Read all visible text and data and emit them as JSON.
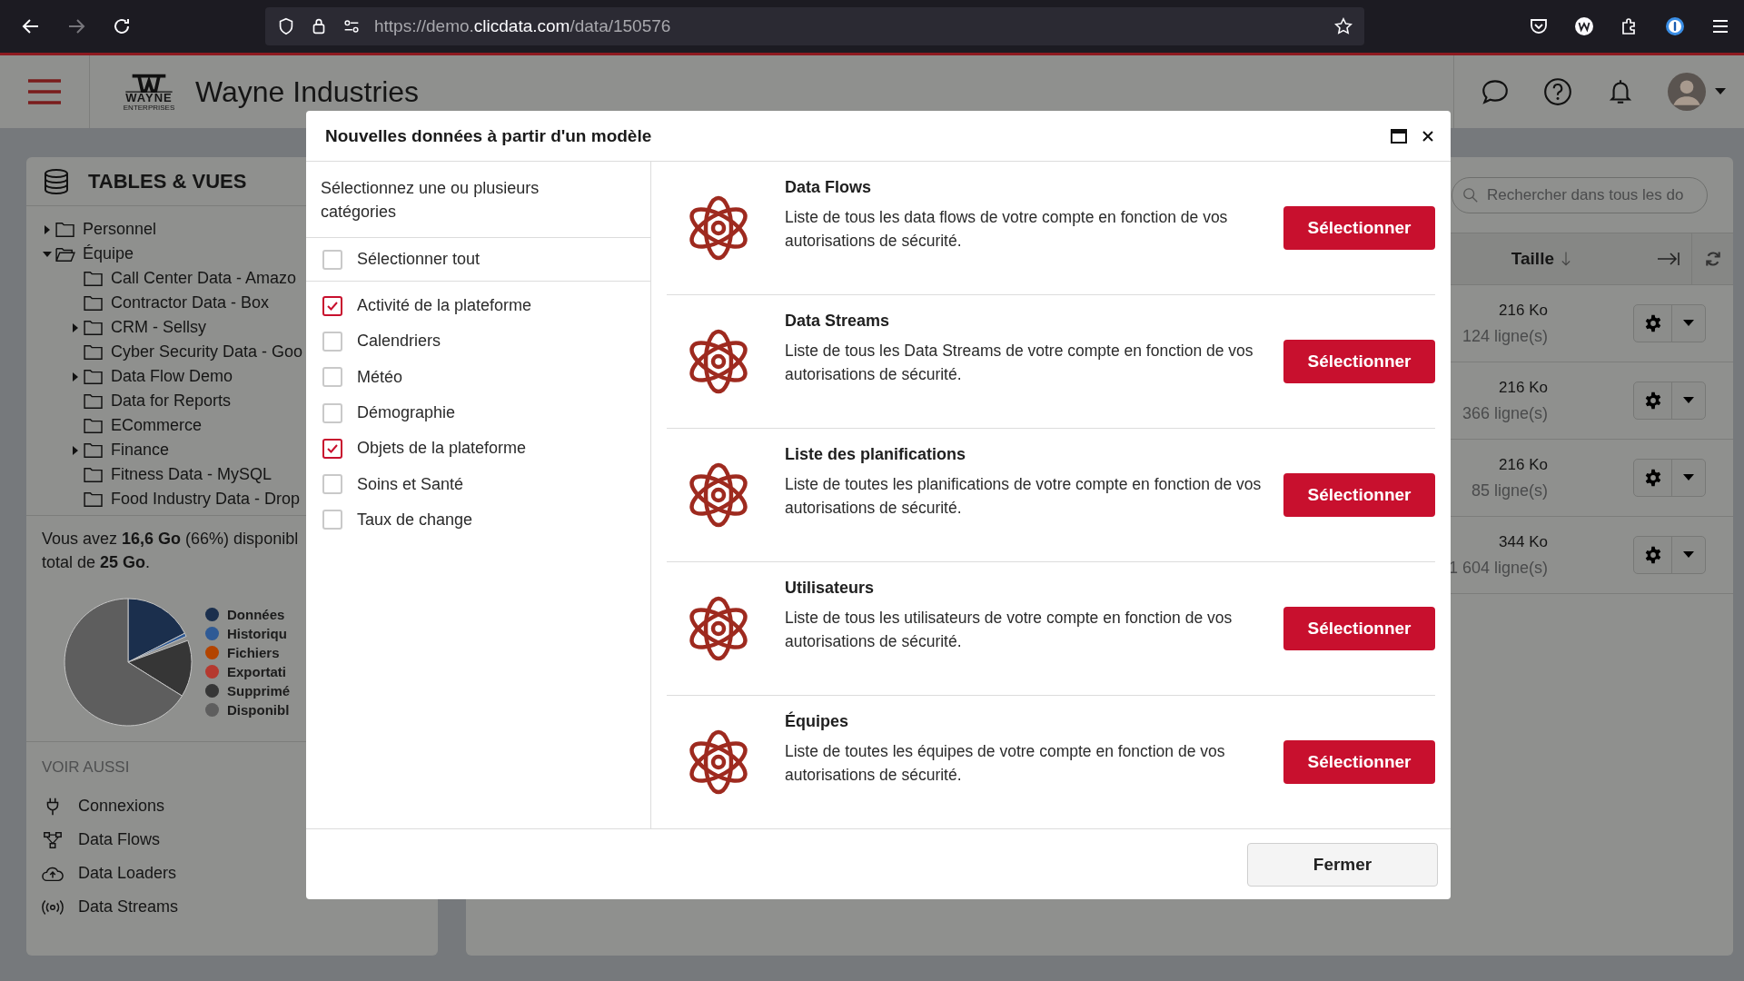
{
  "browser": {
    "url_prefix": "https://demo.",
    "url_domain": "clicdata.com",
    "url_path": "/data/150576"
  },
  "app_header": {
    "logo_text": "WAYNE",
    "logo_subtext": "ENTERPRISES",
    "title": "Wayne Industries"
  },
  "left_panel": {
    "title": "TABLES & VUES",
    "tree": [
      {
        "label": "Personnel",
        "kind": "branch",
        "expanded": false
      },
      {
        "label": "Équipe",
        "kind": "branch",
        "expanded": true,
        "children": [
          {
            "label": "Call Center Data - Amazo",
            "kind": "leaf"
          },
          {
            "label": "Contractor Data - Box",
            "kind": "leaf"
          },
          {
            "label": "CRM - Sellsy",
            "kind": "branch",
            "expanded": false
          },
          {
            "label": "Cyber Security Data - Goo",
            "kind": "leaf"
          },
          {
            "label": "Data Flow Demo",
            "kind": "branch",
            "expanded": false
          },
          {
            "label": "Data for Reports",
            "kind": "leaf"
          },
          {
            "label": "ECommerce",
            "kind": "leaf"
          },
          {
            "label": "Finance",
            "kind": "branch",
            "expanded": false
          },
          {
            "label": "Fitness Data - MySQL",
            "kind": "leaf"
          },
          {
            "label": "Food Industry Data - Drop",
            "kind": "leaf"
          }
        ]
      }
    ],
    "storage_lines": [
      "Vous avez **16,6 Go** (66%) disponibl",
      "total de **25 Go**."
    ],
    "legend": [
      {
        "label": "Données",
        "color": "#1b2f4d"
      },
      {
        "label": "Historiqu",
        "color": "#2f5a95"
      },
      {
        "label": "Fichiers",
        "color": "#b34400"
      },
      {
        "label": "Exportati",
        "color": "#b5392f"
      },
      {
        "label": "Supprimé",
        "color": "#363636"
      },
      {
        "label": "Disponibl",
        "color": "#5e5e5e"
      }
    ],
    "see_also_title": "VOIR AUSSI",
    "see_also": [
      {
        "label": "Connexions",
        "kind": "plug"
      },
      {
        "label": "Data Flows",
        "kind": "flow"
      },
      {
        "label": "Data Loaders",
        "kind": "cloud"
      },
      {
        "label": "Data Streams",
        "kind": "stream"
      }
    ]
  },
  "right_panel": {
    "search": {
      "placeholder": "Rechercher dans tous les do"
    },
    "column": "Taille",
    "rows": [
      {
        "size": "216 Ko",
        "lines": "124 ligne(s)"
      },
      {
        "size": "216 Ko",
        "lines": "366 ligne(s)"
      },
      {
        "size": "216 Ko",
        "lines": "85 ligne(s)"
      },
      {
        "size": "344 Ko",
        "lines": "1 604 ligne(s)"
      }
    ]
  },
  "modal": {
    "title": "Nouvelles données à partir d'un modèle",
    "intro": "Sélectionnez une ou plusieurs catégories",
    "select_all": {
      "label": "Sélectionner tout",
      "checked": false
    },
    "categories": [
      {
        "label": "Activité de la plateforme",
        "checked": true
      },
      {
        "label": "Calendriers",
        "checked": false
      },
      {
        "label": "Météo",
        "checked": false
      },
      {
        "label": "Démographie",
        "checked": false
      },
      {
        "label": "Objets de la plateforme",
        "checked": true
      },
      {
        "label": "Soins et Santé",
        "checked": false
      },
      {
        "label": "Taux de change",
        "checked": false
      }
    ],
    "templates": [
      {
        "title": "Data Flows",
        "description": "Liste de tous les data flows de votre compte en fonction de vos autorisations de sécurité.",
        "button": "Sélectionner"
      },
      {
        "title": "Data Streams",
        "description": "Liste de tous les Data Streams de votre compte en fonction de vos autorisations de sécurité.",
        "button": "Sélectionner"
      },
      {
        "title": "Liste des planifications",
        "description": "Liste de toutes les planifications de votre compte en fonction de vos autorisations de sécurité.",
        "button": "Sélectionner"
      },
      {
        "title": "Utilisateurs",
        "description": "Liste de tous les utilisateurs de votre compte en fonction de vos autorisations de sécurité.",
        "button": "Sélectionner"
      },
      {
        "title": "Équipes",
        "description": "Liste de toutes les équipes de votre compte en fonction de vos autorisations de sécurité.",
        "button": "Sélectionner"
      }
    ],
    "close_button": "Fermer"
  }
}
